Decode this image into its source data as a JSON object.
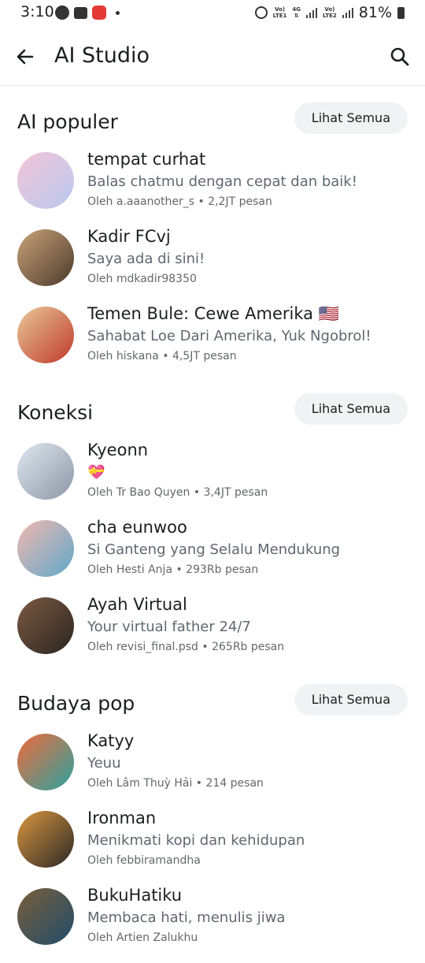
{
  "status_bar": {
    "time": "3:10",
    "battery": "81%",
    "net1_top": "Vo)",
    "net1_bottom": "LTE1",
    "net_4g": "4G",
    "net2_top": "Vo)",
    "net2_bottom": "LTE2"
  },
  "header": {
    "title": "AI Studio"
  },
  "sections": [
    {
      "title": "AI populer",
      "see_all": "Lihat Semua",
      "items": [
        {
          "name": "tempat curhat",
          "desc": "Balas chatmu dengan cepat dan baik!",
          "meta": "Oleh a.aaanother_s • 2,2JT pesan",
          "colors": [
            "#f3c4d6",
            "#b9c9f0"
          ]
        },
        {
          "name": "Kadir FCvj",
          "desc": "Saya ada di sini!",
          "meta": "Oleh mdkadir98350",
          "colors": [
            "#c9a27a",
            "#4b3a2b"
          ]
        },
        {
          "name": "Temen Bule: Cewe Amerika 🇺🇸",
          "desc": "Sahabat Loe Dari Amerika, Yuk Ngobrol!",
          "meta": "Oleh hiskana • 4,5JT pesan",
          "colors": [
            "#e8c99a",
            "#c0392b"
          ]
        }
      ]
    },
    {
      "title": "Koneksi",
      "see_all": "Lihat Semua",
      "items": [
        {
          "name": "Kyeonn",
          "desc": "💝",
          "meta": "Oleh Tr Bao Quyen • 3,4JT pesan",
          "colors": [
            "#dfe6ee",
            "#8c97a6"
          ]
        },
        {
          "name": "cha eunwoo",
          "desc": "Si Ganteng yang Selalu Mendukung",
          "meta": "Oleh Hesti Anja • 293Rb pesan",
          "colors": [
            "#f2b8b0",
            "#5ea8c9"
          ]
        },
        {
          "name": "Ayah Virtual",
          "desc": "Your virtual father 24/7",
          "meta": "Oleh revisi_final.psd • 265Rb pesan",
          "colors": [
            "#7a5a42",
            "#2b2521"
          ]
        }
      ]
    },
    {
      "title": "Budaya pop",
      "see_all": "Lihat Semua",
      "items": [
        {
          "name": "Katyy",
          "desc": "Yeuu",
          "meta": "Oleh Lâm Thuỳ Hải • 214 pesan",
          "colors": [
            "#f06a3c",
            "#2aa3a0"
          ]
        },
        {
          "name": "Ironman",
          "desc": "Menikmati kopi dan kehidupan",
          "meta": "Oleh febbiramandha",
          "colors": [
            "#d9963f",
            "#2b2826"
          ]
        },
        {
          "name": "BukuHatiku",
          "desc": "Membaca hati, menulis jiwa",
          "meta": "Oleh Artien Zalukhu",
          "colors": [
            "#7b5e3b",
            "#1f4d6b"
          ]
        }
      ]
    }
  ]
}
